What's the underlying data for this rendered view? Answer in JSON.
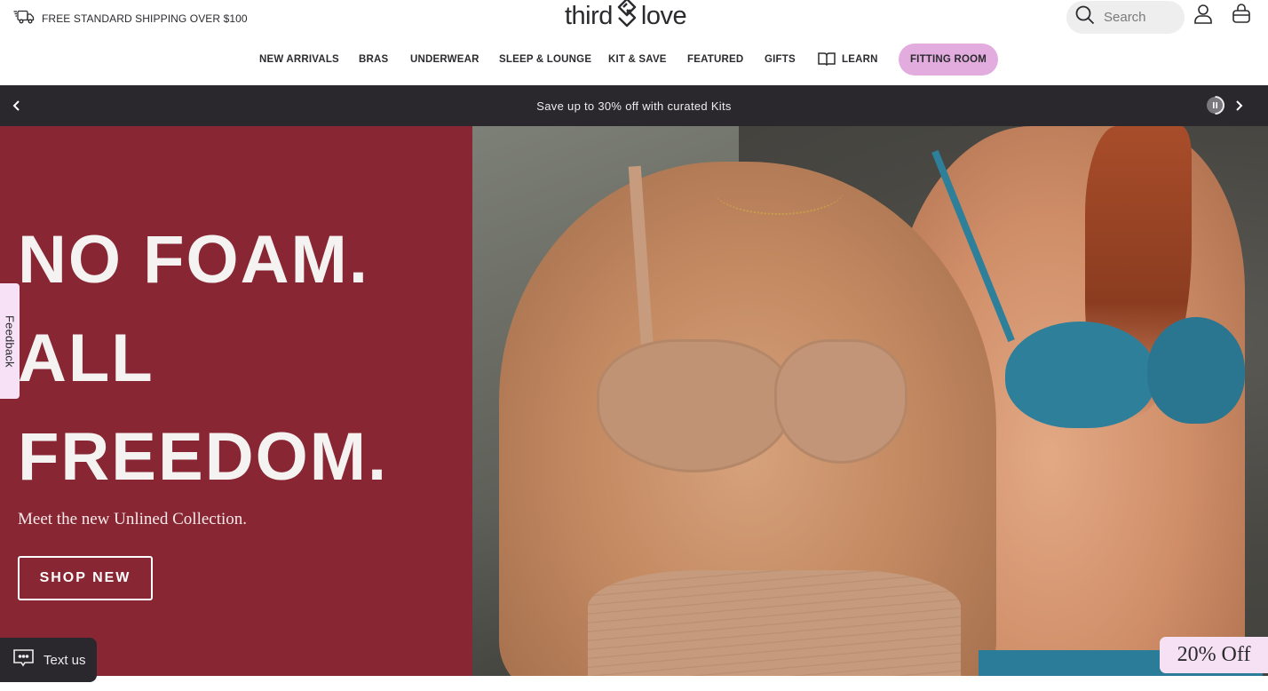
{
  "header": {
    "shipping_icon": "truck-icon",
    "shipping_text": "FREE STANDARD SHIPPING OVER $100",
    "logo_left": "third",
    "logo_right": "love",
    "logo_icon": "diamond-heart-icon",
    "search": {
      "placeholder": "Search",
      "value": "",
      "icon": "search-icon"
    },
    "account_icon": "user-icon",
    "cart_icon": "bag-icon"
  },
  "nav": {
    "items": [
      {
        "label": "NEW ARRIVALS"
      },
      {
        "label": "BRAS"
      },
      {
        "label": "UNDERWEAR"
      },
      {
        "label": "SLEEP & LOUNGE"
      },
      {
        "label": "KIT & SAVE"
      },
      {
        "label": "FEATURED"
      },
      {
        "label": "GIFTS"
      },
      {
        "label": "LEARN",
        "icon": "book-icon"
      }
    ],
    "cta": {
      "label": "FITTING ROOM",
      "color": "#e3acdf"
    }
  },
  "promo": {
    "text": "Save up to 30% off with curated Kits",
    "prev_icon": "chevron-left-icon",
    "next_icon": "chevron-right-icon",
    "pause_icon": "pause-icon",
    "background": "#2b282d"
  },
  "hero": {
    "headline": [
      "NO FOAM.",
      "ALL",
      "FREEDOM."
    ],
    "subhead": "Meet the new Unlined Collection.",
    "button_label": "SHOP NEW",
    "panel_color": "#882733",
    "image_alt": "Two models wearing unlined bras — nude mesh and teal lace"
  },
  "widgets": {
    "feedback_label": "Feedback",
    "text_us_label": "Text us",
    "text_us_icon": "chat-bubble-icon",
    "discount_label": "20% Off"
  }
}
